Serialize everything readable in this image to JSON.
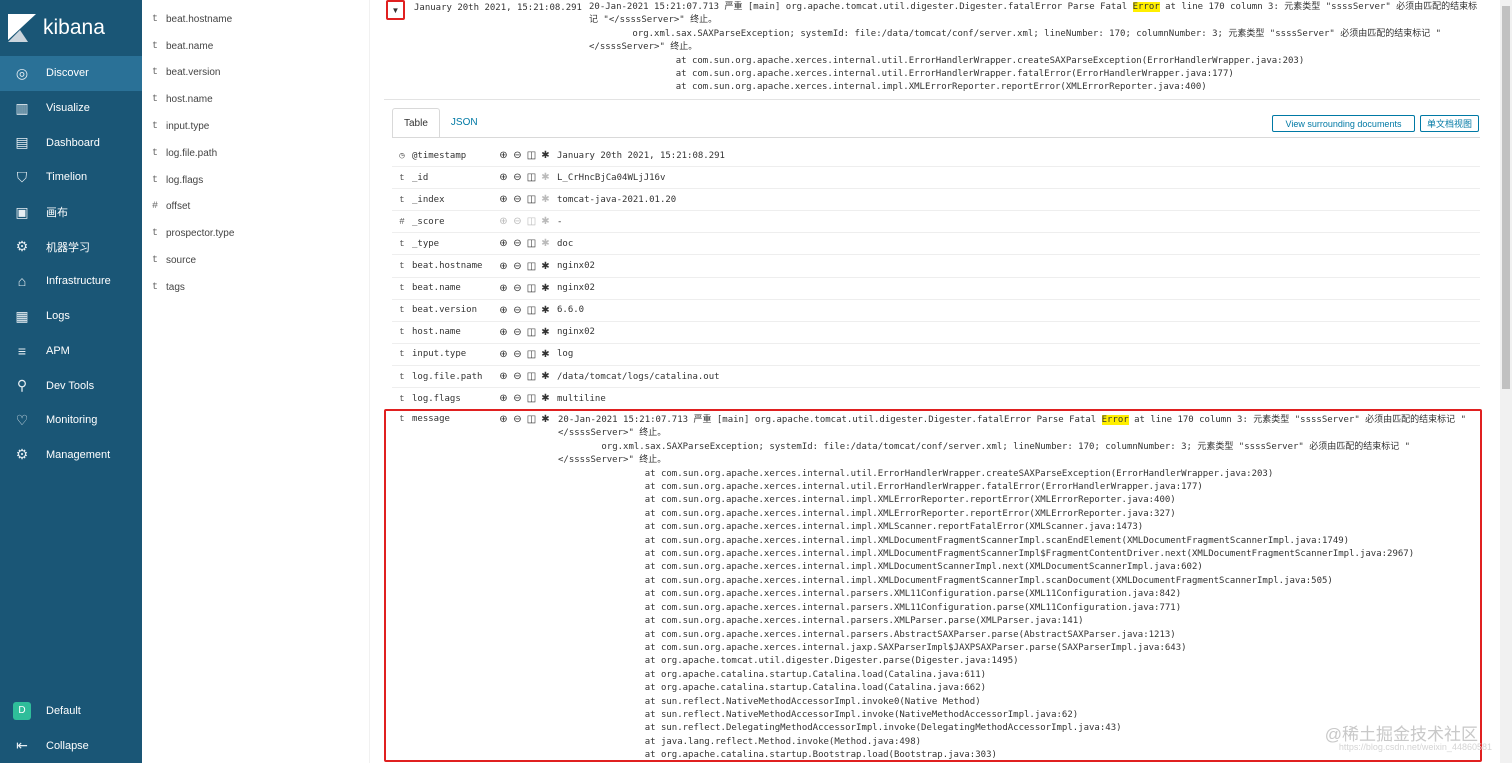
{
  "app": {
    "title": "kibana"
  },
  "sidebar": {
    "items": [
      {
        "label": "Discover",
        "icon": "compass-icon",
        "glyph": "◎"
      },
      {
        "label": "Visualize",
        "icon": "bar-chart-icon",
        "glyph": "▥"
      },
      {
        "label": "Dashboard",
        "icon": "dashboard-icon",
        "glyph": "▤"
      },
      {
        "label": "Timelion",
        "icon": "shield-icon",
        "glyph": "⛉"
      },
      {
        "label": "画布",
        "icon": "canvas-icon",
        "glyph": "▣"
      },
      {
        "label": "机器学习",
        "icon": "ml-icon",
        "glyph": "⚙"
      },
      {
        "label": "Infrastructure",
        "icon": "infrastructure-icon",
        "glyph": "⌂"
      },
      {
        "label": "Logs",
        "icon": "logs-icon",
        "glyph": "▦"
      },
      {
        "label": "APM",
        "icon": "apm-icon",
        "glyph": "≡"
      },
      {
        "label": "Dev Tools",
        "icon": "wrench-icon",
        "glyph": "⚲"
      },
      {
        "label": "Monitoring",
        "icon": "heartbeat-icon",
        "glyph": "♡"
      },
      {
        "label": "Management",
        "icon": "gear-icon",
        "glyph": "⚙"
      }
    ],
    "space": {
      "initial": "D",
      "label": "Default"
    },
    "collapse": {
      "label": "Collapse",
      "glyph": "⇤"
    }
  },
  "fields": [
    {
      "type": "t",
      "name": "beat.hostname"
    },
    {
      "type": "t",
      "name": "beat.name"
    },
    {
      "type": "t",
      "name": "beat.version"
    },
    {
      "type": "t",
      "name": "host.name"
    },
    {
      "type": "t",
      "name": "input.type"
    },
    {
      "type": "t",
      "name": "log.file.path"
    },
    {
      "type": "t",
      "name": "log.flags"
    },
    {
      "type": "#",
      "name": "offset"
    },
    {
      "type": "t",
      "name": "prospector.type"
    },
    {
      "type": "t",
      "name": "source"
    },
    {
      "type": "t",
      "name": "tags"
    }
  ],
  "doc": {
    "timestamp": "January 20th 2021, 15:21:08.291",
    "summary_pre": "20-Jan-2021 15:21:07.713 严重 [main] org.apache.tomcat.util.digester.Digester.fatalError Parse Fatal ",
    "summary_hl": "Error",
    "summary_post": " at line 170 column 3: 元素类型 \"ssssServer\" 必须由匹配的结束标记 \"</ssssServer>\" 终止。\n        org.xml.sax.SAXParseException; systemId: file:/data/tomcat/conf/server.xml; lineNumber: 170; columnNumber: 3; 元素类型 \"ssssServer\" 必须由匹配的结束标记 \"</ssssServer>\" 终止。\n                at com.sun.org.apache.xerces.internal.util.ErrorHandlerWrapper.createSAXParseException(ErrorHandlerWrapper.java:203)\n                at com.sun.org.apache.xerces.internal.util.ErrorHandlerWrapper.fatalError(ErrorHandlerWrapper.java:177)\n                at com.sun.org.apache.xerces.internal.impl.XMLErrorReporter.reportError(XMLErrorReporter.java:400)"
  },
  "tabs": [
    {
      "label": "Table"
    },
    {
      "label": "JSON"
    }
  ],
  "buttons": {
    "surrounding": "View surrounding documents",
    "single": "单文档视图"
  },
  "rows": [
    {
      "type": "◷",
      "name": "@timestamp",
      "value": "January 20th 2021, 15:21:08.291",
      "enabled": true
    },
    {
      "type": "t",
      "name": "_id",
      "value": "L_CrHncBjCa04WLjJ16v",
      "enabled": false
    },
    {
      "type": "t",
      "name": "_index",
      "value": "tomcat-java-2021.01.20",
      "enabled": false
    },
    {
      "type": "#",
      "name": "_score",
      "value": " -",
      "enabled": false,
      "dim": true
    },
    {
      "type": "t",
      "name": "_type",
      "value": "doc",
      "enabled": false
    },
    {
      "type": "t",
      "name": "beat.hostname",
      "value": "nginx02",
      "enabled": true
    },
    {
      "type": "t",
      "name": "beat.name",
      "value": "nginx02",
      "enabled": true
    },
    {
      "type": "t",
      "name": "beat.version",
      "value": "6.6.0",
      "enabled": true
    },
    {
      "type": "t",
      "name": "host.name",
      "value": "nginx02",
      "enabled": true
    },
    {
      "type": "t",
      "name": "input.type",
      "value": "log",
      "enabled": true
    },
    {
      "type": "t",
      "name": "log.file.path",
      "value": "/data/tomcat/logs/catalina.out",
      "enabled": true
    },
    {
      "type": "t",
      "name": "log.flags",
      "value": "multiline",
      "enabled": true
    }
  ],
  "message": {
    "type": "t",
    "name": "message",
    "pre": "20-Jan-2021 15:21:07.713 严重 [main] org.apache.tomcat.util.digester.Digester.fatalError Parse Fatal ",
    "hl": "Error",
    "post": " at line 170 column 3: 元素类型 \"ssssServer\" 必须由匹配的结束标记 \"</ssssServer>\" 终止。\n        org.xml.sax.SAXParseException; systemId: file:/data/tomcat/conf/server.xml; lineNumber: 170; columnNumber: 3; 元素类型 \"ssssServer\" 必须由匹配的结束标记 \"</ssssServer>\" 终止。\n                at com.sun.org.apache.xerces.internal.util.ErrorHandlerWrapper.createSAXParseException(ErrorHandlerWrapper.java:203)\n                at com.sun.org.apache.xerces.internal.util.ErrorHandlerWrapper.fatalError(ErrorHandlerWrapper.java:177)\n                at com.sun.org.apache.xerces.internal.impl.XMLErrorReporter.reportError(XMLErrorReporter.java:400)\n                at com.sun.org.apache.xerces.internal.impl.XMLErrorReporter.reportError(XMLErrorReporter.java:327)\n                at com.sun.org.apache.xerces.internal.impl.XMLScanner.reportFatalError(XMLScanner.java:1473)\n                at com.sun.org.apache.xerces.internal.impl.XMLDocumentFragmentScannerImpl.scanEndElement(XMLDocumentFragmentScannerImpl.java:1749)\n                at com.sun.org.apache.xerces.internal.impl.XMLDocumentFragmentScannerImpl$FragmentContentDriver.next(XMLDocumentFragmentScannerImpl.java:2967)\n                at com.sun.org.apache.xerces.internal.impl.XMLDocumentScannerImpl.next(XMLDocumentScannerImpl.java:602)\n                at com.sun.org.apache.xerces.internal.impl.XMLDocumentFragmentScannerImpl.scanDocument(XMLDocumentFragmentScannerImpl.java:505)\n                at com.sun.org.apache.xerces.internal.parsers.XML11Configuration.parse(XML11Configuration.java:842)\n                at com.sun.org.apache.xerces.internal.parsers.XML11Configuration.parse(XML11Configuration.java:771)\n                at com.sun.org.apache.xerces.internal.parsers.XMLParser.parse(XMLParser.java:141)\n                at com.sun.org.apache.xerces.internal.parsers.AbstractSAXParser.parse(AbstractSAXParser.java:1213)\n                at com.sun.org.apache.xerces.internal.jaxp.SAXParserImpl$JAXPSAXParser.parse(SAXParserImpl.java:643)\n                at org.apache.tomcat.util.digester.Digester.parse(Digester.java:1495)\n                at org.apache.catalina.startup.Catalina.load(Catalina.java:611)\n                at org.apache.catalina.startup.Catalina.load(Catalina.java:662)\n                at sun.reflect.NativeMethodAccessorImpl.invoke0(Native Method)\n                at sun.reflect.NativeMethodAccessorImpl.invoke(NativeMethodAccessorImpl.java:62)\n                at sun.reflect.DelegatingMethodAccessorImpl.invoke(DelegatingMethodAccessorImpl.java:43)\n                at java.lang.reflect.Method.invoke(Method.java:498)\n                at org.apache.catalina.startup.Bootstrap.load(Bootstrap.java:303)"
  },
  "watermark": {
    "text": "@稀土掘金技术社区",
    "url": "https://blog.csdn.net/weixin_44860581"
  },
  "colors": {
    "sidebar": "#1a5676",
    "sidebar_active": "#2a7197",
    "link": "#0079a5",
    "highlight": "#ffef00",
    "annotation": "#e02020"
  }
}
